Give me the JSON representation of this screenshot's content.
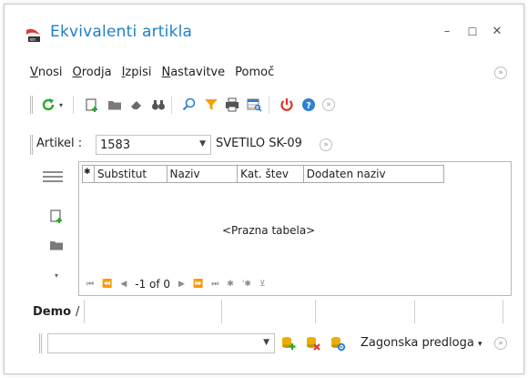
{
  "window": {
    "title": "Ekvivalenti artikla",
    "controls": {
      "minimize": "–",
      "maximize": "☐",
      "close": "✕"
    }
  },
  "menu": {
    "items": [
      {
        "accel": "V",
        "rest": "nosi"
      },
      {
        "accel": "O",
        "rest": "rodja"
      },
      {
        "accel": "I",
        "rest": "zpisi"
      },
      {
        "accel": "N",
        "rest": "astavitve"
      },
      {
        "accel": "",
        "rest": "Pomoč"
      }
    ]
  },
  "toolbar": {
    "icons": [
      "refresh-icon",
      "new-document-icon",
      "folder-icon",
      "eraser-icon",
      "binoculars-icon",
      "search-icon",
      "filter-icon",
      "print-icon",
      "table-search-icon",
      "power-icon",
      "help-icon",
      "chevron-more-icon"
    ]
  },
  "artikel": {
    "label": "Artikel :",
    "value": "1583",
    "description": "SVETILO SK-09"
  },
  "grid": {
    "row_marker": "✱",
    "columns": [
      "Substitut",
      "Naziv",
      "Kat. štev",
      "Dodaten naziv"
    ],
    "empty_text": "<Prazna tabela>",
    "navigator": {
      "page_text": "-1 of 0",
      "buttons": [
        "⏮",
        "⏪",
        "◀",
        "▶",
        "⏩",
        "⏭",
        "✱",
        "'✱",
        "⊻"
      ]
    }
  },
  "tabs": {
    "active": "Demo",
    "separator": "/"
  },
  "bottom": {
    "combo_value": "",
    "template_label": "Zagonska predloga",
    "template_arrow": "▾"
  },
  "colors": {
    "title": "#1f7fc8",
    "refresh": "#2aa82a",
    "filter": "#f5a000",
    "power": "#d9342b",
    "help": "#2f7fd6",
    "db_yellow": "#e8b000"
  }
}
